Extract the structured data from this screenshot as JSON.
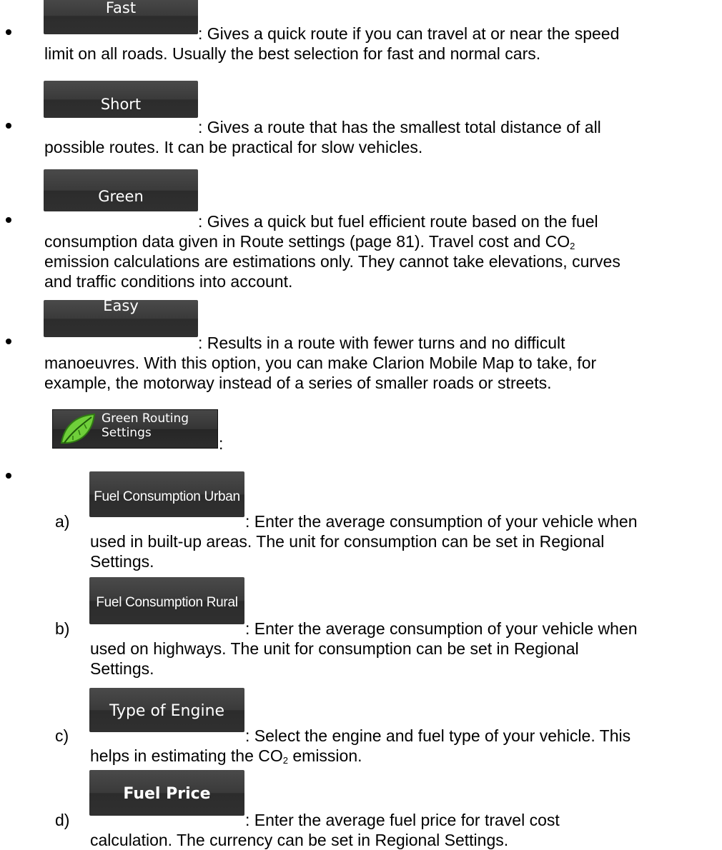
{
  "route_methods": [
    {
      "button": "Fast",
      "line1": ": Gives a quick route if you can travel at or near the speed",
      "line2": "limit on all roads. Usually the best selection for fast and normal cars."
    },
    {
      "button": "Short",
      "line1": ": Gives a route that has the smallest total distance of all",
      "line2": "possible routes. It can be practical for slow vehicles."
    },
    {
      "button": "Green",
      "line1": ": Gives a quick but fuel efficient route based on the fuel",
      "line2_a": "consumption data given in Route settings (page 81). Travel cost and CO",
      "line2_sub": "2",
      "line3": "emission calculations are estimations only. They cannot take elevations, curves",
      "line4": "and traffic conditions into account."
    },
    {
      "button": "Easy",
      "line1": ": Results in a route with fewer turns and no difficult",
      "line2": "manoeuvres. With this option, you can make Clarion Mobile Map to take, for",
      "line3": "example, the motorway instead of a series of smaller roads or streets."
    }
  ],
  "green_routing": {
    "label_line1": "Green Routing",
    "label_line2": "Settings",
    "icon": "leaf-icon",
    "colon": ":"
  },
  "settings": [
    {
      "marker": "a)",
      "button": "Fuel Consumption Urban",
      "line1": ": Enter the average consumption of your vehicle when",
      "line2": "used in built-up areas. The unit for consumption can be set in Regional",
      "line3": "Settings."
    },
    {
      "marker": "b)",
      "button": "Fuel Consumption Rural",
      "line1": ": Enter the average consumption of your vehicle when",
      "line2": "used on highways. The unit for consumption can be set in Regional",
      "line3": "Settings."
    },
    {
      "marker": "c)",
      "button": "Type of Engine",
      "line1": ": Select the engine and fuel type of your vehicle. This",
      "line2_a": "helps in estimating the CO",
      "line2_sub": "2",
      "line2_b": " emission."
    },
    {
      "marker": "d)",
      "button": "Fuel Price",
      "line1": ": Enter the average fuel price for travel cost",
      "line2": "calculation. The currency can be set in Regional Settings."
    }
  ]
}
